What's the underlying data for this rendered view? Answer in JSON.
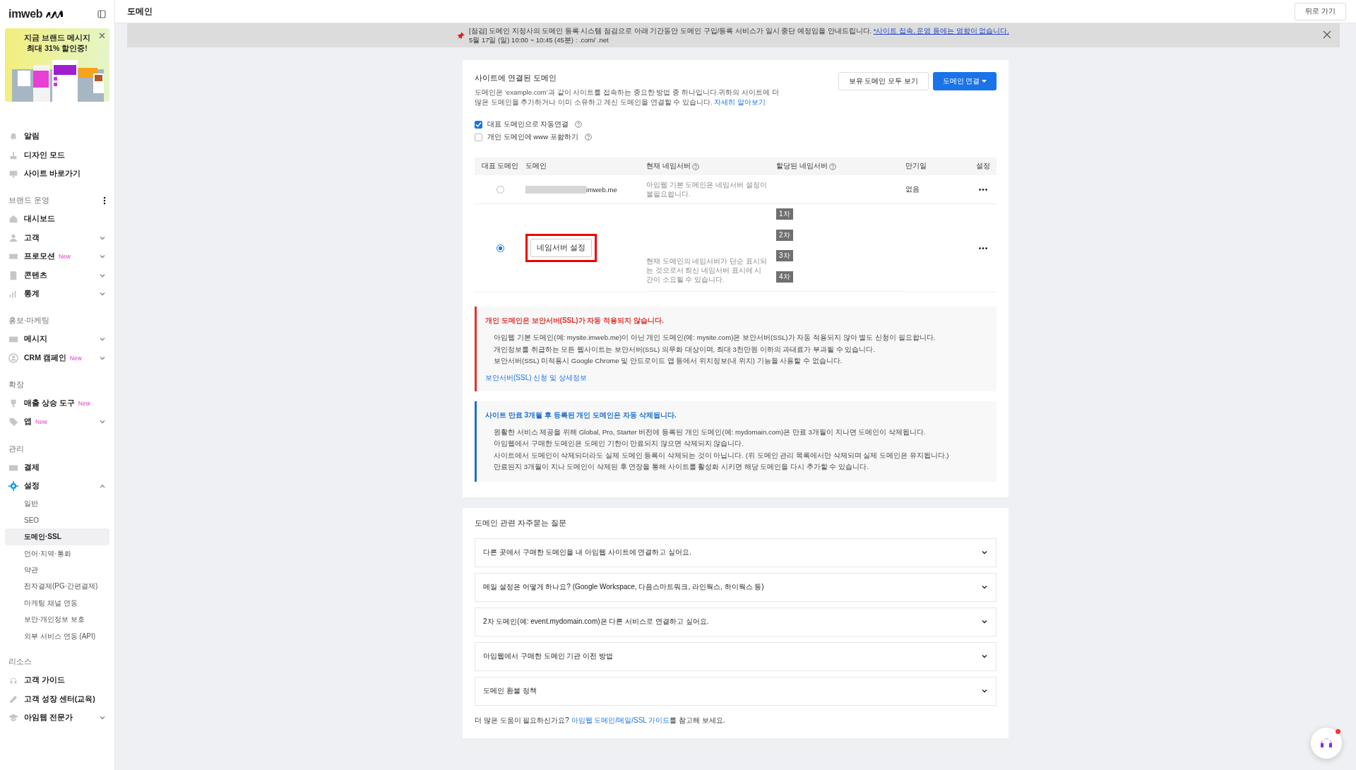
{
  "sidebar": {
    "logo": "imweb",
    "promo": {
      "lines": [
        "지금 브랜드 메시지",
        "최대 31% 할인중!"
      ]
    },
    "groups": [
      {
        "items": [
          {
            "label": "알림"
          },
          {
            "label": "디자인 모드"
          },
          {
            "label": "사이트 바로가기"
          }
        ]
      },
      {
        "heading": "브랜드 운영",
        "menu": true,
        "items": [
          {
            "label": "대시보드"
          },
          {
            "label": "고객",
            "expanded": false
          },
          {
            "label": "프로모션",
            "badge": "New",
            "expanded": false
          },
          {
            "label": "콘텐츠",
            "expanded": false
          },
          {
            "label": "통계",
            "expanded": false
          }
        ]
      },
      {
        "heading": "홍보·마케팅",
        "items": [
          {
            "label": "메시지",
            "expanded": false
          },
          {
            "label": "CRM 캠페인",
            "badge": "New",
            "expanded": false
          }
        ]
      },
      {
        "heading": "확장",
        "items": [
          {
            "label": "매출 상승 도구",
            "badge": "New"
          },
          {
            "label": "앱",
            "badge": "New",
            "expanded": false
          }
        ]
      },
      {
        "heading": "관리",
        "items": [
          {
            "label": "결제"
          },
          {
            "label": "설정",
            "expanded": true,
            "children": [
              {
                "label": "일반",
                "selected": false
              },
              {
                "label": "SEO",
                "selected": false
              },
              {
                "label": "도메인·SSL",
                "selected": true
              },
              {
                "label": "언어·지역·통화",
                "selected": false
              },
              {
                "label": "약관",
                "selected": false
              },
              {
                "label": "전자결제(PG·간편결제)",
                "selected": false
              },
              {
                "label": "마케팅 채널 연동",
                "selected": false
              },
              {
                "label": "보안·개인정보 보호",
                "selected": false
              },
              {
                "label": "외부 서비스 연동 (API)",
                "selected": false
              }
            ]
          }
        ]
      },
      {
        "heading": "리소스",
        "items": [
          {
            "label": "고객 가이드"
          },
          {
            "label": "고객 성장 센터(교육)"
          },
          {
            "label": "아임웹 전문가",
            "expanded": false
          }
        ]
      }
    ]
  },
  "header": {
    "title": "도메인",
    "back_button": "뒤로 가기"
  },
  "notice": {
    "text": "[점검] 도메인 지정사의 도메인 등록 시스템 점검으로 아래 기간동안 도메인 구입/등록 서비스가 일시 중단 예정임을 안내드립니다.",
    "link": "*사이트 접속, 운영 등에는 영향이 없습니다.",
    "schedule": "5월 17일 (일) 10:00 ~ 10:45 (45분) : .com/ .net"
  },
  "domain": {
    "title": "사이트에 연결된 도메인",
    "buttons": [
      {
        "label": "보유 도메인 모두 보기",
        "kind": "secondary"
      },
      {
        "label": "도메인 연결",
        "kind": "primary"
      }
    ],
    "description": "도메인은 ‘example.com’과 같이 사이트를 접속하는 중요한 방법 중 하나입니다.귀하의 사이트에 더 많은 도메인을 추가하거나 이미 소유하고 계신 도메인을 연결할 수 있습니다.",
    "description_link": "자세히 알아보기",
    "options": [
      {
        "label": "대표 도메인으로 자동연결",
        "checked": true
      },
      {
        "label": "개인 도메인에 www 포함하기",
        "checked": false
      }
    ],
    "columns": [
      {
        "label": "대표 도메인",
        "help": false
      },
      {
        "label": "도메인",
        "help": false
      },
      {
        "label": "현재 네임서버",
        "help": true
      },
      {
        "label": "할당된 네임서버",
        "help": true
      },
      {
        "label": "만기일",
        "help": false
      },
      {
        "label": "설정",
        "help": false
      }
    ],
    "rows": [
      {
        "selected": false,
        "kind": "default",
        "domain": "imweb.me",
        "current_ns": "아임웹 기본 도메인은 네임서버 설정이 불필요합니다.",
        "expiry": "없음"
      },
      {
        "selected": true,
        "kind": "custom",
        "button": "네임서버 설정",
        "highlighted": true,
        "ns_tags": [
          "1차",
          "2차",
          "3차",
          "4차"
        ],
        "current_ns": "현재 도메인의 네임서버가 단순 표시되는 것으로서 최신 네임서버 표시에 시간이 소요될 수 있습니다."
      }
    ],
    "alerts": [
      {
        "kind": "error",
        "title": "개인 도메인은 보안서버(SSL)가 자동 적용되지 않습니다.",
        "lines": [
          "아임웹 기본 도메인(예: mysite.imweb.me)이 아닌 개인 도메인(예: mysite.com)은 보안서버(SSL)가 자동 적용되지 않아 별도 신청이 필요합니다.",
          "개인정보를 취급하는 모든 웹사이트는 보안서버(SSL) 의무화 대상이며, 최대 3천만원 이하의 과태료가 부과될 수 있습니다.",
          "보안서버(SSL) 미적용시 Google Chrome 및 안드로이드 앱 등에서 위치정보(내 위치) 기능을 사용할 수 없습니다."
        ],
        "link": "보안서버(SSL) 신청 및 상세정보"
      },
      {
        "kind": "info",
        "title": "사이트 만료 3개월 후 등록된 개인 도메인은 자동 삭제됩니다.",
        "lines": [
          "원활한 서비스 제공을 위해 Global, Pro, Starter 버전에 등록된 개인 도메인(예: mydomain.com)은 만료 3개월이 지나면 도메인이 삭제됩니다.",
          "아임웹에서 구매한 도메인은 도메인 기한이 만료되지 않으면 삭제되지 않습니다.",
          "사이트에서 도메인이 삭제되더라도 실제 도메인 등록이 삭제되는 것이 아닙니다. (위 도메인 관리 목록에서만 삭제되며 실제 도메인은 유지됩니다.)",
          "만료된지 3개월이 지나 도메인이 삭제된 후 연장을 통해 사이트를 활성화 시키면 해당 도메인을 다시 추가할 수 있습니다."
        ]
      }
    ]
  },
  "faq": {
    "title": "도메인 관련 자주묻는 질문",
    "items": [
      {
        "question": "다른 곳에서 구매한 도메인을 내 아임웹 사이트에 연결하고 싶어요.",
        "expanded": false
      },
      {
        "question": "메일 설정은 어떻게 하나요? (Google Workspace, 다음스마트워크, 라인웍스, 하이웍스 등)",
        "expanded": false
      },
      {
        "question": "2차 도메인(예: event.mydomain.com)은 다른 서비스로 연결하고 싶어요.",
        "expanded": false
      },
      {
        "question": "아임웹에서 구매한 도메인 기관 이전 방법",
        "expanded": false
      },
      {
        "question": "도메인 환불 정책",
        "expanded": false
      }
    ],
    "footer_before": "더 많은 도움이 필요하신가요? ",
    "footer_link": "아임웹 도메인/메일/SSL 가이드",
    "footer_after": "를 참고해 보세요."
  }
}
